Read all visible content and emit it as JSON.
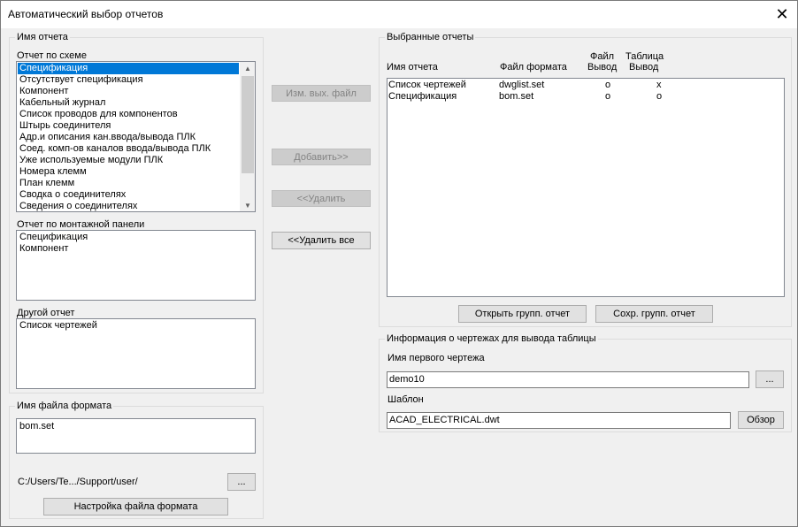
{
  "window": {
    "title": "Автоматический выбор отчетов",
    "close_glyph": "✕"
  },
  "report_name": {
    "group_title": "Имя отчета",
    "schematic_label": "Отчет по схеме",
    "schematic_items": [
      "Спецификация",
      "Отсутствует спецификация",
      "Компонент",
      "Кабельный журнал",
      "Список проводов для компонентов",
      "Штырь соединителя",
      "Адр.и описания кан.ввода/вывода ПЛК",
      "Соед. комп-ов каналов ввода/вывода ПЛК",
      "Уже используемые модули ПЛК",
      "Номера клемм",
      "План клемм",
      "Сводка о соединителях",
      "Сведения о соединителях"
    ],
    "panel_label": "Отчет по монтажной панели",
    "panel_items": [
      "Спецификация",
      "Компонент"
    ],
    "other_label": "Другой отчет",
    "other_items": [
      "Список чертежей"
    ]
  },
  "format_file": {
    "group_title": "Имя файла формата",
    "items": [
      "bom.set"
    ],
    "path": "C:/Users/Te.../Support/user/",
    "browse_label": "...",
    "settings_button": "Настройка файла формата"
  },
  "middle_buttons": {
    "change_output": "Изм. вых. файл",
    "add": "Добавить>>",
    "remove": "<<Удалить",
    "remove_all": "<<Удалить все"
  },
  "selected_reports": {
    "group_title": "Выбранные отчеты",
    "headers": {
      "name": "Имя отчета",
      "format_file": "Файл формата",
      "file_output_1": "Файл",
      "file_output_2": "Вывод",
      "table_output_1": "Таблица",
      "table_output_2": "Вывод"
    },
    "rows": [
      {
        "name": "Список чертежей",
        "format": "dwglist.set",
        "file": "o",
        "table": "x"
      },
      {
        "name": "Спецификация",
        "format": "bom.set",
        "file": "o",
        "table": "o"
      }
    ],
    "open_group_button": "Открыть групп. отчет",
    "save_group_button": "Сохр. групп. отчет"
  },
  "drawing_info": {
    "group_title": "Информация о чертежах для вывода таблицы",
    "first_drawing_label": "Имя первого чертежа",
    "first_drawing_value": "demo10",
    "browse_label": "...",
    "template_label": "Шаблон",
    "template_value": "ACAD_ELECTRICAL.dwt",
    "template_browse": "Обзор"
  }
}
